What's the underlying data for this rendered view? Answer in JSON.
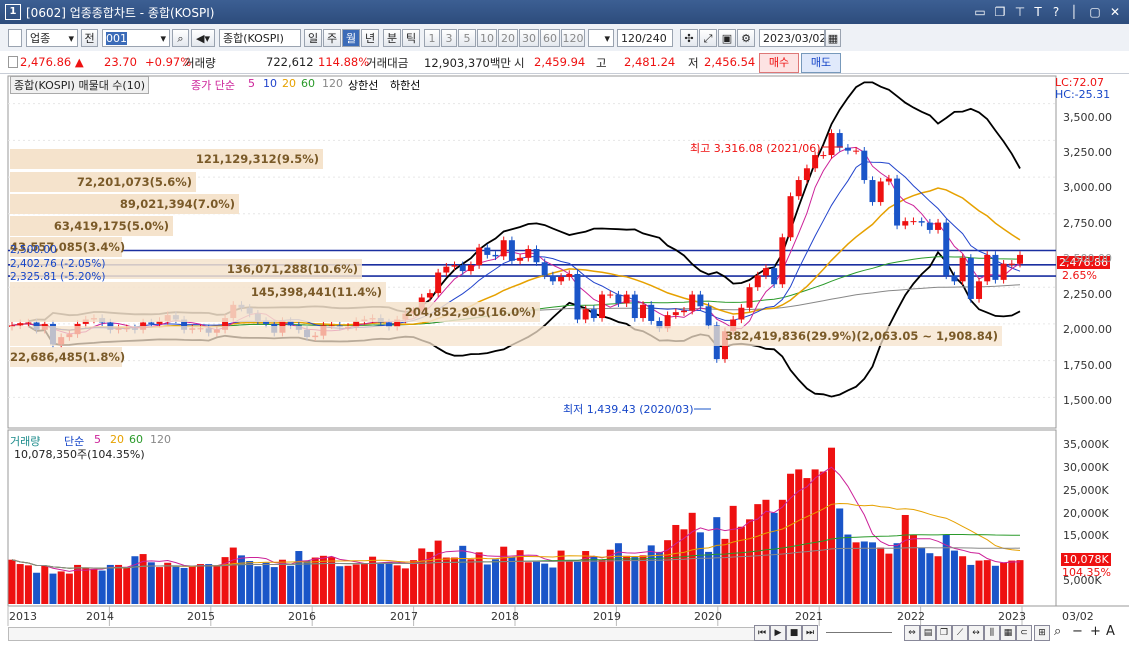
{
  "window": {
    "app_icon": "1",
    "title": "[0602] 업종종합차트 - 종합(KOSPI)",
    "controls": [
      "▭",
      "❐",
      "⊤",
      "T",
      "?",
      "│",
      "✕"
    ]
  },
  "toolbar": {
    "market_select": "업종",
    "prev_label": "전",
    "code": "001",
    "sound_icon": "◀▾",
    "name_field": "종합(KOSPI)",
    "periods": [
      "일",
      "주",
      "월",
      "년",
      "분",
      "틱"
    ],
    "active_period": "월",
    "intervals": [
      "1",
      "3",
      "5",
      "10",
      "20",
      "30",
      "60",
      "120"
    ],
    "count": "120/240",
    "date": "2023/03/02"
  },
  "price_row": {
    "price": "2,476.86 ▲",
    "change": "23.70",
    "change_pct": "+0.97%",
    "volume_label": "거래량",
    "volume": "722,612",
    "volume_pct": "114.88%",
    "amount_label": "거래대금",
    "amount": "12,903,370백만",
    "open_label": "시",
    "open": "2,459.94",
    "high_label": "고",
    "high": "2,481.24",
    "low_label": "저",
    "low": "2,456.54",
    "buy": "매수",
    "sell": "매도"
  },
  "legend_main": {
    "title": "종합(KOSPI) 매물대 수(10)",
    "ma_label": "종가 단순",
    "ma": [
      "5",
      "10",
      "20",
      "60",
      "120"
    ],
    "ma_colors": [
      "#cc2299",
      "#2244cc",
      "#e6a100",
      "#2a9a2a",
      "#888888"
    ],
    "upper": "상한선",
    "lower": "하한선",
    "lc": "LC:72.07",
    "hc": "HC:-25.31"
  },
  "volume_profile": [
    "121,129,312(9.5%)",
    "72,201,073(5.6%)",
    "89,021,394(7.0%)",
    "63,419,175(5.0%)",
    "43,557,085(3.4%)",
    "136,071,288(10.6%)",
    "145,398,441(11.4%)",
    "204,852,905(16.0%)",
    "382,419,836(29.9%)(2,063.05 ~ 1,908.84)",
    "22,686,485(1.8%)"
  ],
  "hlines": [
    "2,500.00",
    "2,402.76 (-2.05%)",
    "2,325.81 (-5.20%)"
  ],
  "annotations": {
    "high": "최고 3,316.08 (2021/06)",
    "low": "최저 1,439.43 (2020/03)",
    "last": "2,476.86",
    "pct": "2.65%"
  },
  "y_axis": [
    "3,500.00",
    "3,250.00",
    "3,000.00",
    "2,750.00",
    "2,500.00",
    "2,250.00",
    "2,000.00",
    "1,750.00",
    "1,500.00"
  ],
  "legend_vol": {
    "title": "거래량",
    "ma_label": "단순",
    "ma": [
      "5",
      "20",
      "60",
      "120"
    ],
    "value": "10,078,350주(104.35%)"
  },
  "vol_axis": [
    "35,000K",
    "30,000K",
    "25,000K",
    "20,000K",
    "15,000K",
    "5,000K"
  ],
  "vol_last": "10,078K",
  "vol_pct": "104.35%",
  "x_axis": [
    "2013",
    "2014",
    "2015",
    "2016",
    "2017",
    "2018",
    "2019",
    "2020",
    "2021",
    "2022",
    "2023"
  ],
  "x_end": "03/02",
  "chart_data": {
    "type": "candlestick",
    "period": "monthly",
    "ylim": [
      1400,
      3600
    ],
    "closes": [
      1990,
      2005,
      2010,
      1960,
      2000,
      1860,
      1910,
      1930,
      2000,
      2030,
      2040,
      2010,
      1960,
      1970,
      1970,
      1960,
      2010,
      2000,
      2020,
      2060,
      2030,
      1960,
      1970,
      1970,
      1940,
      1960,
      2040,
      2130,
      2110,
      2070,
      2020,
      2000,
      1940,
      2020,
      1990,
      1960,
      1910,
      1920,
      1990,
      1990,
      1980,
      1980,
      2020,
      2030,
      2040,
      2010,
      1980,
      2030,
      2070,
      2090,
      2180,
      2210,
      2350,
      2390,
      2400,
      2360,
      2400,
      2520,
      2470,
      2460,
      2570,
      2430,
      2450,
      2510,
      2420,
      2330,
      2290,
      2320,
      2340,
      2030,
      2100,
      2040,
      2200,
      2200,
      2140,
      2200,
      2040,
      2130,
      2020,
      1970,
      2060,
      2080,
      2090,
      2200,
      2120,
      1990,
      1760,
      1950,
      2030,
      2110,
      2250,
      2330,
      2380,
      2270,
      2590,
      2870,
      2980,
      3060,
      3150,
      3150,
      3300,
      3200,
      3180,
      3180,
      2980,
      2830,
      2970,
      2990,
      2670,
      2700,
      2700,
      2690,
      2640,
      2690,
      2330,
      2290,
      2450,
      2170,
      2290,
      2470,
      2300,
      2410,
      2410,
      2470
    ],
    "volume_k": [
      10200,
      9200,
      8900,
      7200,
      8800,
      7000,
      7500,
      7000,
      9000,
      8400,
      8100,
      7700,
      9000,
      9000,
      8500,
      11000,
      11500,
      9600,
      8500,
      9500,
      8600,
      8300,
      8700,
      9200,
      9200,
      8700,
      10800,
      13000,
      11200,
      9900,
      8700,
      9500,
      8500,
      10200,
      8800,
      12200,
      10000,
      10700,
      11100,
      10800,
      8700,
      8800,
      9100,
      9200,
      10900,
      9500,
      9600,
      8900,
      8200,
      10100,
      12800,
      12000,
      14600,
      10700,
      10700,
      13400,
      10300,
      11900,
      9100,
      10300,
      13200,
      10800,
      12400,
      9600,
      10000,
      9300,
      8400,
      12300,
      10000,
      9700,
      12200,
      11000,
      10200,
      12500,
      14000,
      11100,
      10800,
      11200,
      13500,
      12000,
      14700,
      18200,
      17200,
      21000,
      16500,
      12000,
      20000,
      15000,
      22600,
      17800,
      19500,
      23000,
      24000,
      21000,
      24000,
      30000,
      31000,
      29000,
      31000,
      30500,
      36000,
      22000,
      16000,
      14200,
      14400,
      14200,
      13000,
      11600,
      14000,
      20500,
      16000,
      13000,
      11700,
      11000,
      16000,
      12300,
      11000,
      9000,
      10000,
      10100,
      8800,
      9500,
      10000,
      10100
    ],
    "ma5_color": "#cc2299",
    "ma10_color": "#2244cc",
    "ma20_color": "#e6a100",
    "ma60_color": "#2a9a2a",
    "ma120_color": "#888888"
  }
}
